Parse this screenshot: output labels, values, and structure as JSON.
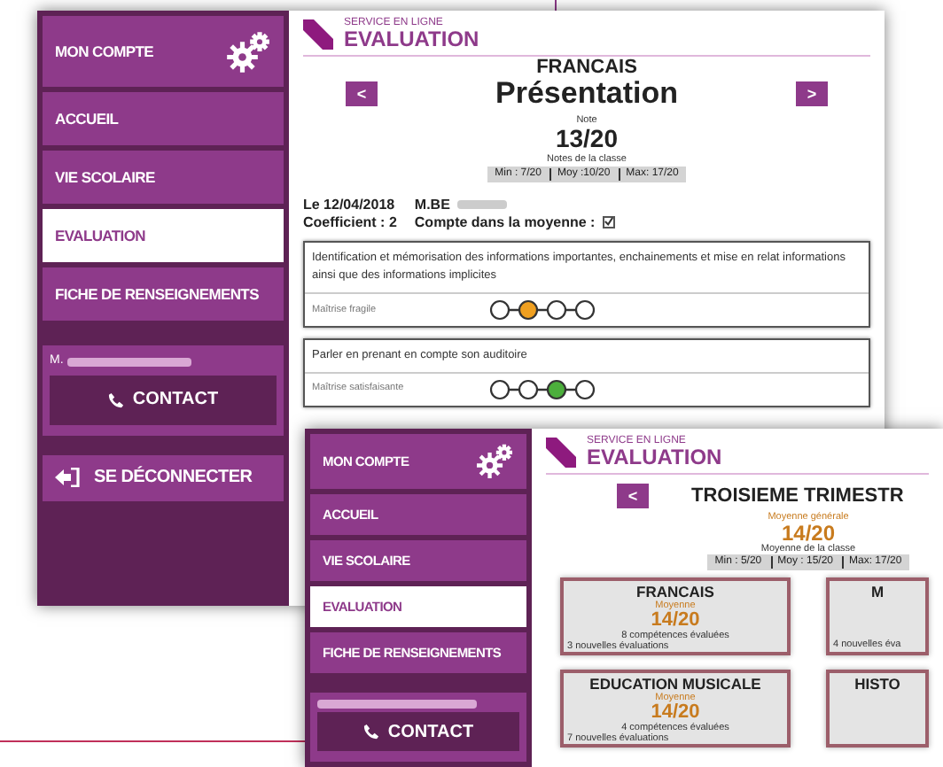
{
  "back_window": {
    "sidebar": {
      "items": [
        {
          "label": "MON COMPTE",
          "kind": "account",
          "selected": false
        },
        {
          "label": "ACCUEIL",
          "kind": "link",
          "selected": false
        },
        {
          "label": "VIE SCOLAIRE",
          "kind": "link",
          "selected": false
        },
        {
          "label": "EVALUATION",
          "kind": "link",
          "selected": true
        },
        {
          "label": "FICHE DE RENSEIGNEMENTS",
          "kind": "link",
          "selected": false
        }
      ],
      "user_label": "M.",
      "contact_button": "CONTACT",
      "logout_button": "SE DÉCONNECTER"
    },
    "header": {
      "kicker": "SERVICE EN LIGNE",
      "title": "EVALUATION"
    },
    "subject": "FRANCAIS",
    "assessment": "Présentation",
    "prev_button": "<",
    "next_button": ">",
    "grade_label": "Note",
    "grade": "13/20",
    "class_label": "Notes de la classe",
    "class_stats": [
      "Min : 7/20",
      "Moy :10/20",
      "Max: 17/20"
    ],
    "date": "Le 12/04/2018",
    "teacher": "M.BE",
    "coefficient": "Coefficient : 2",
    "counts_label": "Compte dans la moyenne :",
    "counts_checked": true,
    "competences": [
      {
        "text": "Identification et mémorisation des informations importantes, enchainements et mise en relat informations ainsi que des informations implicites",
        "mastery": "Maîtrise fragile",
        "color": "#f0a020",
        "steps": [
          {
            "selected": false
          },
          {
            "selected": true
          },
          {
            "selected": false
          },
          {
            "selected": false
          }
        ]
      },
      {
        "text": "Parler en prenant en compte son auditoire",
        "mastery": "Maîtrise satisfaisante",
        "color": "#4caf3c",
        "steps": [
          {
            "selected": false
          },
          {
            "selected": false
          },
          {
            "selected": true
          },
          {
            "selected": false
          }
        ]
      }
    ]
  },
  "front_window": {
    "sidebar": {
      "items": [
        {
          "label": "MON COMPTE",
          "kind": "account",
          "selected": false
        },
        {
          "label": "ACCUEIL",
          "kind": "link",
          "selected": false
        },
        {
          "label": "VIE SCOLAIRE",
          "kind": "link",
          "selected": false
        },
        {
          "label": "EVALUATION",
          "kind": "link",
          "selected": true
        },
        {
          "label": "FICHE DE RENSEIGNEMENTS",
          "kind": "link",
          "selected": false
        }
      ],
      "contact_button": "CONTACT"
    },
    "header": {
      "kicker": "SERVICE EN LIGNE",
      "title": "EVALUATION"
    },
    "prev_button": "<",
    "period": "TROISIEME TRIMESTR",
    "average_label": "Moyenne générale",
    "average": "14/20",
    "class_label": "Moyenne de la classe",
    "class_stats": [
      "Min : 5/20",
      "Moy : 15/20",
      "Max: 17/20"
    ],
    "subjects": [
      {
        "name": "FRANCAIS",
        "average_label": "Moyenne",
        "average": "14/20",
        "competences": "8 compétences évaluées",
        "new": "3 nouvelles évaluations"
      },
      {
        "name": "M",
        "new": "4 nouvelles éva"
      },
      {
        "name": "EDUCATION MUSICALE",
        "average_label": "Moyenne",
        "average": "14/20",
        "competences": "4 compétences évaluées",
        "new": "7 nouvelles évaluations"
      },
      {
        "name": "HISTO"
      }
    ]
  }
}
